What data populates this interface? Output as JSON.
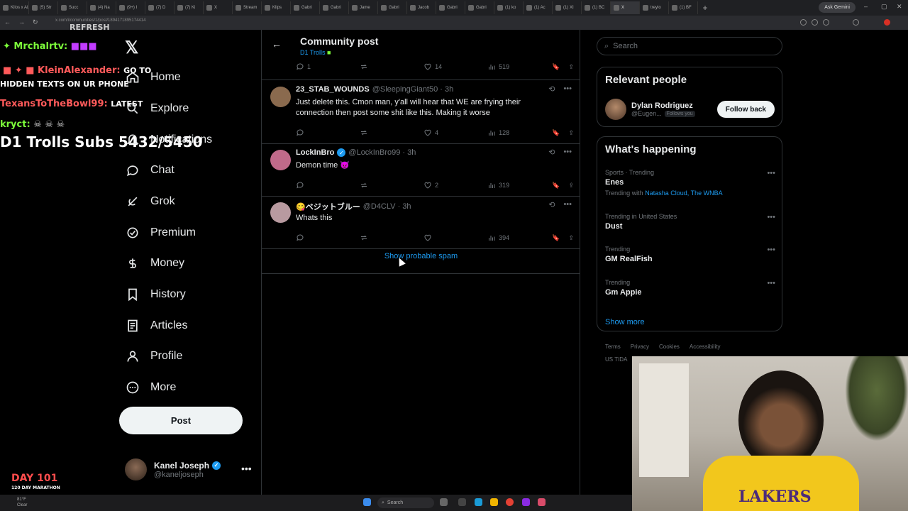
{
  "browser": {
    "tabs": [
      "Kilos x ALL GIRLS",
      "(5) Str",
      "Succ",
      "(4) Na",
      "(9+) I",
      "(7) D",
      "(7) Ki",
      "X",
      "Stream",
      "Klips",
      "Gabri",
      "Gabri",
      "Jame",
      "Gabri",
      "Jacob",
      "Gabri",
      "Gabri",
      "(1) ko",
      "(1) Ac",
      "(1) XI",
      "(1) BC",
      "X",
      "treylo",
      "(1) BF"
    ],
    "ask_gemini": "Ask Gemini",
    "url": "x.com/i/communities/1/post/1894171895174414"
  },
  "overlay": {
    "line1_name": "Mrchalrtv:",
    "line2_name": "KleinAlexander:",
    "line2_text": "GO TO",
    "line3_text": "HIDDEN TEXTS ON UR PHONE",
    "line4_name": "TexansToTheBowl99:",
    "line4_text": "LATEST",
    "line5_name": "kryct:",
    "subs": "D1 Trolls Subs 5432/5450",
    "refresh": "REFRESH",
    "day": "DAY 101",
    "marathon": "120 DAY MARATHON"
  },
  "nav": {
    "items": [
      {
        "label": "Home",
        "icon": "home-icon"
      },
      {
        "label": "Explore",
        "icon": "search-icon"
      },
      {
        "label": "Notifications",
        "icon": "bell-icon"
      },
      {
        "label": "Chat",
        "icon": "chat-icon"
      },
      {
        "label": "Grok",
        "icon": "grok-icon"
      },
      {
        "label": "Premium",
        "icon": "premium-icon"
      },
      {
        "label": "Money",
        "icon": "money-icon"
      },
      {
        "label": "History",
        "icon": "bookmark-icon"
      },
      {
        "label": "Articles",
        "icon": "article-icon"
      },
      {
        "label": "Profile",
        "icon": "profile-icon"
      },
      {
        "label": "More",
        "icon": "more-icon"
      }
    ],
    "post_label": "Post",
    "account_name": "Kanel Joseph",
    "account_handle": "@kaneljoseph"
  },
  "header": {
    "title": "Community post",
    "subtitle": "D1 Trolls"
  },
  "top_actions": {
    "replies": "1",
    "likes": "14",
    "views": "519"
  },
  "replies": [
    {
      "name": "23_STAB_WOUNDS",
      "handle": "@SleepingGiant50 · 3h",
      "text": "Just delete this. Cmon man, y'all will hear that WE are frying their connection then post some shit like this. Making it worse",
      "likes": "4",
      "views": "128",
      "avatar_color": "#8a6a4e"
    },
    {
      "name": "LockInBro",
      "handle": "@LockInBro99 · 3h",
      "text": "Demon time 😈",
      "likes": "2",
      "views": "319",
      "avatar_color": "#c06a8a"
    },
    {
      "name": "😋ベジットブルー",
      "handle": "@D4CLV · 3h",
      "text": "Whats this",
      "likes": "",
      "views": "394",
      "avatar_color": "#b89aa0"
    }
  ],
  "show_spam": "Show probable spam",
  "right": {
    "search_placeholder": "Search",
    "relevant_title": "Relevant people",
    "person_name": "Dylan Rodriguez",
    "person_handle": "@Eugen...",
    "follows_you": "Follows you",
    "follow_back": "Follow back",
    "happening_title": "What's happening",
    "trends": [
      {
        "meta": "Sports · Trending",
        "name": "Enes",
        "with_label": "Trending with",
        "with": "Natasha Cloud, The WNBA"
      },
      {
        "meta": "Trending in United States",
        "name": "Dust"
      },
      {
        "meta": "Trending",
        "name": "GM RealFish"
      },
      {
        "meta": "Trending",
        "name": "Gm Appie"
      }
    ],
    "show_more": "Show more",
    "footer": [
      "Terms",
      "Privacy",
      "Cookies",
      "Accessibility"
    ],
    "footer2": "US TIDA"
  },
  "taskbar": {
    "search": "Search",
    "weather_temp": "81°F",
    "weather_desc": "Clear"
  },
  "webcam": {
    "shirt_text": "LAKERS"
  }
}
